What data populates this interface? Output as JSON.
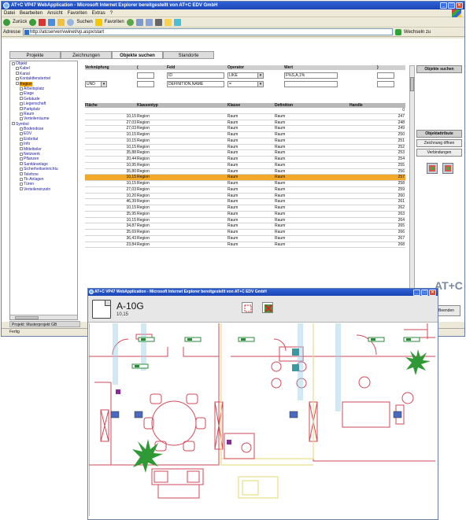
{
  "browser": {
    "title": "AT+C VP47 WebApplication - Microsoft Internet Explorer bereitgestellt von AT+C EDV GmbH",
    "menu": [
      "Datei",
      "Bearbeiten",
      "Ansicht",
      "Favoriten",
      "Extras",
      "?"
    ],
    "toolbar": {
      "back": "Zurück",
      "search": "Suchen",
      "favorites": "Favoriten"
    },
    "address_label": "Adresse",
    "address": "http://atcserver/vwinet/vp.aspx/start",
    "go_label": "Wechseln zu",
    "status": "Fertig"
  },
  "tabs": [
    {
      "label": "Projekte",
      "active": false
    },
    {
      "label": "Zeichnungen",
      "active": false
    },
    {
      "label": "Objekte suchen",
      "active": true
    },
    {
      "label": "Standorte",
      "active": false
    }
  ],
  "tree": {
    "items": [
      {
        "label": "Objekt",
        "level": 0
      },
      {
        "label": "Kabel",
        "level": 1
      },
      {
        "label": "Kanal",
        "level": 1
      },
      {
        "label": "Kontaktfenstertrel",
        "level": 1
      },
      {
        "label": "Region",
        "level": 1,
        "selected": true
      },
      {
        "label": "Arbeitsplatz",
        "level": 2
      },
      {
        "label": "Etage",
        "level": 2
      },
      {
        "label": "Gebäude",
        "level": 2
      },
      {
        "label": "Liegenschaft",
        "level": 2
      },
      {
        "label": "Parkplatz",
        "level": 2
      },
      {
        "label": "Raum",
        "level": 2
      },
      {
        "label": "Verteilerräume",
        "level": 2
      },
      {
        "label": "Symbol",
        "level": 0
      },
      {
        "label": "Bodendose",
        "level": 2
      },
      {
        "label": "EDV",
        "level": 2
      },
      {
        "label": "Einbritat",
        "level": 2
      },
      {
        "label": "Info",
        "level": 2
      },
      {
        "label": "Mittelteiler",
        "level": 2
      },
      {
        "label": "Netzwerk",
        "level": 2
      },
      {
        "label": "Pflanzen",
        "level": 2
      },
      {
        "label": "Sanitäranlage",
        "level": 2
      },
      {
        "label": "Sicherheitseinrichtu",
        "level": 2
      },
      {
        "label": "Telefone",
        "level": 2
      },
      {
        "label": "Tk-Anlagen",
        "level": 2
      },
      {
        "label": "Türen",
        "level": 2
      },
      {
        "label": "Verteilereinzeln",
        "level": 2
      }
    ],
    "project_label": "Projekt: Musterprojekt GB"
  },
  "filter": {
    "headers": [
      "Verknüpfung",
      "(",
      "Feld",
      "Operator",
      "Wert",
      ")"
    ],
    "rows": [
      {
        "link": "",
        "open": "",
        "field": "ID",
        "operator": "LIKE",
        "value": "F%S,A,1%",
        "close": ""
      },
      {
        "link": "UND",
        "open": "",
        "field": "DEFINITION,NAME",
        "operator": "=",
        "value": "",
        "close": ""
      }
    ],
    "search_button": "Objekte suchen"
  },
  "results": {
    "headers": [
      "Fläche",
      "Klassentyp",
      "Klasse",
      "Definition",
      "Handle"
    ],
    "rows": [
      {
        "area": "",
        "type": "",
        "class": "",
        "definition": "",
        "handle": "0"
      },
      {
        "area": "10,15",
        "type": "Region",
        "class": "Raum",
        "definition": "Raum",
        "handle": "247"
      },
      {
        "area": "27,03",
        "type": "Region",
        "class": "Raum",
        "definition": "Raum",
        "handle": "248"
      },
      {
        "area": "27,03",
        "type": "Region",
        "class": "Raum",
        "definition": "Raum",
        "handle": "249"
      },
      {
        "area": "10,15",
        "type": "Region",
        "class": "Raum",
        "definition": "Raum",
        "handle": "250"
      },
      {
        "area": "10,15",
        "type": "Region",
        "class": "Raum",
        "definition": "Raum",
        "handle": "251"
      },
      {
        "area": "10,15",
        "type": "Region",
        "class": "Raum",
        "definition": "Raum",
        "handle": "252"
      },
      {
        "area": "35,88",
        "type": "Region",
        "class": "Raum",
        "definition": "Raum",
        "handle": "253"
      },
      {
        "area": "20,44",
        "type": "Region",
        "class": "Raum",
        "definition": "Raum",
        "handle": "254"
      },
      {
        "area": "10,95",
        "type": "Region",
        "class": "Raum",
        "definition": "Raum",
        "handle": "255"
      },
      {
        "area": "35,80",
        "type": "Region",
        "class": "Raum",
        "definition": "Raum",
        "handle": "256"
      },
      {
        "area": "10,15",
        "type": "Region",
        "class": "Raum",
        "definition": "Raum",
        "handle": "257",
        "selected": true
      },
      {
        "area": "10,15",
        "type": "Region",
        "class": "Raum",
        "definition": "Raum",
        "handle": "258"
      },
      {
        "area": "27,03",
        "type": "Region",
        "class": "Raum",
        "definition": "Raum",
        "handle": "259"
      },
      {
        "area": "10,20",
        "type": "Region",
        "class": "Raum",
        "definition": "Raum",
        "handle": "260"
      },
      {
        "area": "46,39",
        "type": "Region",
        "class": "Raum",
        "definition": "Raum",
        "handle": "261"
      },
      {
        "area": "10,15",
        "type": "Region",
        "class": "Raum",
        "definition": "Raum",
        "handle": "262"
      },
      {
        "area": "35,95",
        "type": "Region",
        "class": "Raum",
        "definition": "Raum",
        "handle": "263"
      },
      {
        "area": "10,15",
        "type": "Region",
        "class": "Raum",
        "definition": "Raum",
        "handle": "264"
      },
      {
        "area": "34,87",
        "type": "Region",
        "class": "Raum",
        "definition": "Raum",
        "handle": "265"
      },
      {
        "area": "35,69",
        "type": "Region",
        "class": "Raum",
        "definition": "Raum",
        "handle": "266"
      },
      {
        "area": "36,43",
        "type": "Region",
        "class": "Raum",
        "definition": "Raum",
        "handle": "267"
      },
      {
        "area": "23,84",
        "type": "Region",
        "class": "Raum",
        "definition": "Raum",
        "handle": "268"
      }
    ]
  },
  "right_panel": {
    "show_objects": "Objektattribute",
    "open_drawing": "Zeichnung öffnen",
    "links": "Verbindungen",
    "exit": "Beenden"
  },
  "popup": {
    "title": "AT+C VP47 WebApplication - Microsoft Internet Explorer bereitgestellt von AT+C EDV GmbH",
    "room_name": "A-10G",
    "room_area": "10,15"
  },
  "brand": "AT+C",
  "colors": {
    "selection": "#f2a828",
    "titlebar": "#1f4fc4",
    "wall_red": "#d24a5a",
    "wall_yellow": "#e6e08a",
    "plant_green": "#2f9a35"
  }
}
